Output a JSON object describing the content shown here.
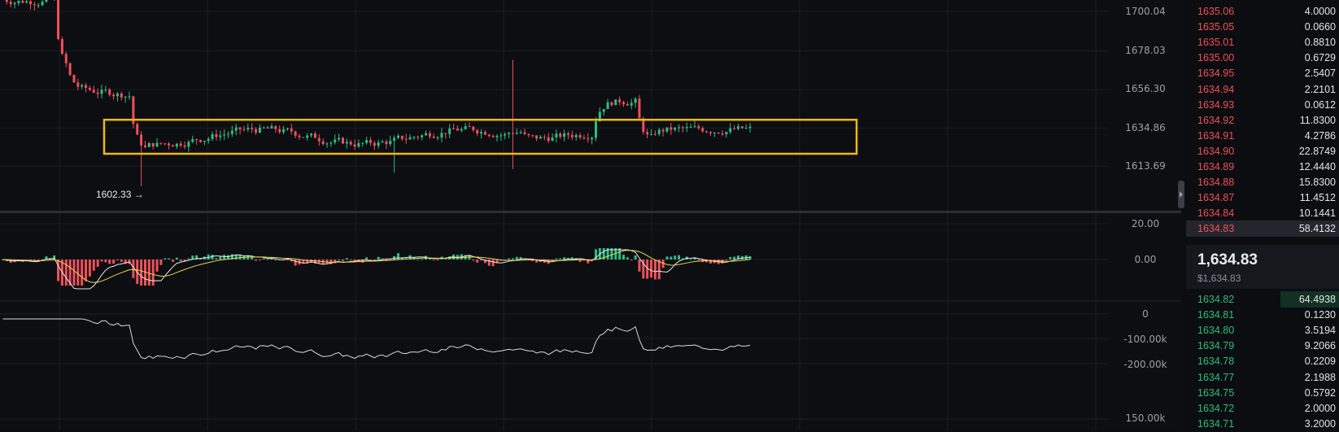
{
  "price_axis": {
    "labels": [
      "1700.04",
      "1678.03",
      "1656.30",
      "1634.86",
      "1613.69"
    ],
    "values": [
      1700.04,
      1678.03,
      1656.3,
      1634.86,
      1613.69
    ]
  },
  "low_marker": {
    "label": "1602.33 →",
    "value": 1602.33
  },
  "macd_axis": {
    "labels": [
      "20.00",
      "0.00"
    ],
    "values": [
      20,
      0
    ]
  },
  "cvd_axis": {
    "labels": [
      "0",
      "-100.00k",
      "-200.00k",
      "150.00k"
    ]
  },
  "highlight_box": {
    "color": "#f0b90b",
    "top_price": 1639.5,
    "bottom_price": 1620.5
  },
  "colors": {
    "up": "#2ebd85",
    "down": "#f0505a",
    "macd_line": "#e6e8eb",
    "signal_line": "#e8d54a",
    "cvd_line": "#d6d9de"
  },
  "orderbook": {
    "asks": [
      {
        "price": "1635.06",
        "qty": "4.0000"
      },
      {
        "price": "1635.05",
        "qty": "0.0660"
      },
      {
        "price": "1635.01",
        "qty": "0.8810"
      },
      {
        "price": "1635.00",
        "qty": "0.6729"
      },
      {
        "price": "1634.95",
        "qty": "2.5407"
      },
      {
        "price": "1634.94",
        "qty": "2.2101"
      },
      {
        "price": "1634.93",
        "qty": "0.0612"
      },
      {
        "price": "1634.92",
        "qty": "11.8300"
      },
      {
        "price": "1634.91",
        "qty": "4.2786"
      },
      {
        "price": "1634.90",
        "qty": "22.8749"
      },
      {
        "price": "1634.89",
        "qty": "12.4440"
      },
      {
        "price": "1634.88",
        "qty": "15.8300"
      },
      {
        "price": "1634.87",
        "qty": "11.4512"
      },
      {
        "price": "1634.84",
        "qty": "10.1441"
      },
      {
        "price": "1634.83",
        "qty": "58.4132"
      }
    ],
    "mid_price": "1,634.83",
    "mid_usd": "$1,634.83",
    "bids": [
      {
        "price": "1634.82",
        "qty": "64.4938"
      },
      {
        "price": "1634.81",
        "qty": "0.1230"
      },
      {
        "price": "1634.80",
        "qty": "3.5194"
      },
      {
        "price": "1634.79",
        "qty": "9.2066"
      },
      {
        "price": "1634.78",
        "qty": "0.2209"
      },
      {
        "price": "1634.77",
        "qty": "2.1988"
      },
      {
        "price": "1634.75",
        "qty": "0.5792"
      },
      {
        "price": "1634.72",
        "qty": "2.0000"
      },
      {
        "price": "1634.71",
        "qty": "3.2000"
      }
    ]
  }
}
